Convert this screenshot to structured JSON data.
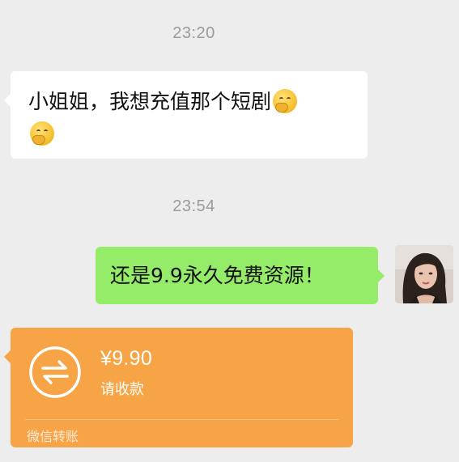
{
  "chat": {
    "timestamp_1": "23:20",
    "timestamp_2": "23:54",
    "incoming_message": {
      "text": "小姐姐，我想充值那个短剧",
      "emojis": [
        "shy-face-emoji",
        "shy-face-emoji"
      ]
    },
    "outgoing_message": {
      "text": "还是9.9永久免费资源！"
    },
    "transfer": {
      "amount": "¥9.90",
      "status": "请收款",
      "footer": "微信转账",
      "icon": "transfer-arrows-icon"
    }
  },
  "colors": {
    "background": "#ededed",
    "incoming_bubble": "#ffffff",
    "outgoing_bubble": "#95ec69",
    "transfer_bubble": "#f6a445",
    "timestamp_text": "#9a9a9a"
  }
}
